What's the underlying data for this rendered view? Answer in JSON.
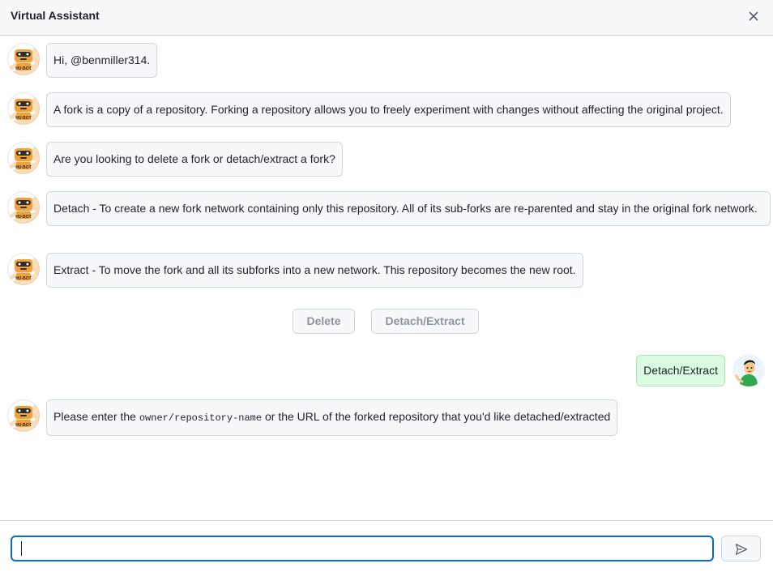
{
  "header": {
    "title": "Virtual Assistant",
    "close_icon": "close-icon"
  },
  "bot": {
    "avatar_icon": "hubot-avatar",
    "avatar_text": "HU-BOT"
  },
  "messages": [
    {
      "from": "bot",
      "text": "Hi, @benmiller314."
    },
    {
      "from": "bot",
      "text": "A fork is a copy of a repository. Forking a repository allows you to freely experiment with changes without affecting the original project."
    },
    {
      "from": "bot",
      "text": "Are you looking to delete a fork or detach/extract a fork?"
    },
    {
      "from": "bot",
      "text": "Detach - To create a new fork network containing only this repository. All of its sub-forks are re-parented and stay in the original fork network."
    },
    {
      "from": "bot",
      "text": "Extract - To move the fork and all its subforks into a new network. This repository becomes the new root."
    }
  ],
  "choices": {
    "delete_label": "Delete",
    "detach_label": "Detach/Extract"
  },
  "user_reply": {
    "text": "Detach/Extract",
    "avatar_icon": "user-avatar"
  },
  "bot_prompt": {
    "before": "Please enter the ",
    "code": "owner/repository-name",
    "after": " or the URL of the forked repository that you'd like detached/extracted"
  },
  "input": {
    "value": "",
    "placeholder": "",
    "send_icon": "send-icon"
  },
  "colors": {
    "header_bg": "#f6f8fa",
    "bubble_bg": "#f6f8fa",
    "user_bubble_bg": "#dafbe1",
    "focus_border": "#0969da",
    "bot_orange": "#f0a13a"
  }
}
